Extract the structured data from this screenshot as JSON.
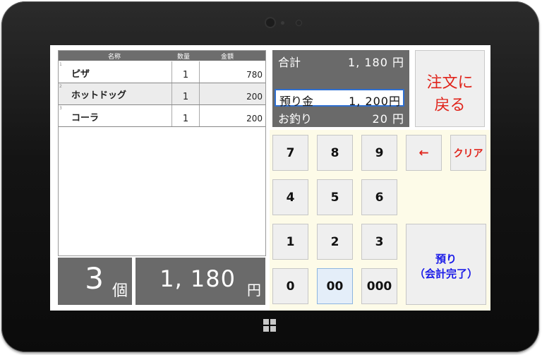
{
  "order_list": {
    "headers": {
      "name": "名称",
      "qty": "数量",
      "amount": "金額"
    },
    "rows": [
      {
        "num": "1",
        "name": "ピザ",
        "qty": "1",
        "amount": "780"
      },
      {
        "num": "2",
        "name": "ホットドッグ",
        "qty": "1",
        "amount": "200"
      },
      {
        "num": "3",
        "name": "コーラ",
        "qty": "1",
        "amount": "200"
      }
    ]
  },
  "summary": {
    "count": "3",
    "count_unit": "個",
    "total": "1, 180",
    "total_unit": "円"
  },
  "payment": {
    "total_label": "合計",
    "total_value": "1, 180 円",
    "deposit_label": "預り金",
    "deposit_value": "1, 200円",
    "change_label": "お釣り",
    "change_value": "20 円"
  },
  "back_button": {
    "line1": "注文に",
    "line2": "戻る"
  },
  "keypad": {
    "k7": "7",
    "k8": "8",
    "k9": "9",
    "k4": "4",
    "k5": "5",
    "k6": "6",
    "k1": "1",
    "k2": "2",
    "k3": "3",
    "k0": "0",
    "k00": "00",
    "k000": "000",
    "backspace": "←",
    "clear": "クリア"
  },
  "complete_button": {
    "line1": "預り",
    "line2": "（会計完了）"
  },
  "colors": {
    "panel_gray": "#6a6a6a",
    "accent_red": "#e0241b",
    "accent_blue": "#1b1be8",
    "keypad_bg": "#fdfbe8"
  }
}
